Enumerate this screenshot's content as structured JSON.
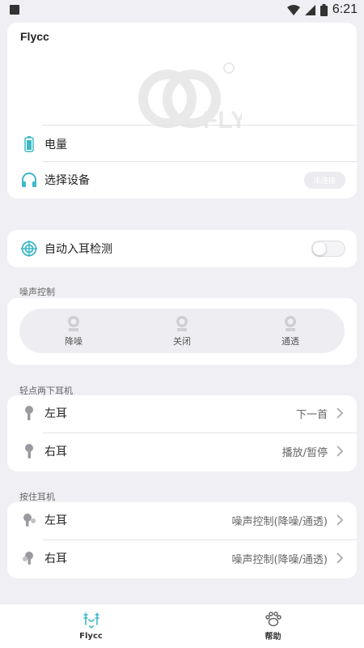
{
  "status_bar": {
    "time": "6:21"
  },
  "header": {
    "brand": "Flycc"
  },
  "device_card": {
    "battery_label": "电量",
    "select_device_label": "选择设备",
    "select_device_status": "未连接"
  },
  "auto_ear": {
    "label": "自动入耳检测",
    "enabled": false
  },
  "noise_control": {
    "title": "噪声控制",
    "options": [
      "降噪",
      "关闭",
      "通透"
    ]
  },
  "double_tap": {
    "title": "轻点两下耳机",
    "items": [
      {
        "label": "左耳",
        "value": "下一首"
      },
      {
        "label": "右耳",
        "value": "播放/暂停"
      }
    ]
  },
  "long_press": {
    "title": "按住耳机",
    "items": [
      {
        "label": "左耳",
        "value": "噪声控制(降噪/通透)"
      },
      {
        "label": "右耳",
        "value": "噪声控制(降噪/通透)"
      }
    ]
  },
  "bottom_nav": {
    "items": [
      {
        "label": "Flycc",
        "icon": "earbuds-icon",
        "active": true
      },
      {
        "label": "帮助",
        "icon": "paw-icon",
        "active": false
      }
    ]
  },
  "colors": {
    "accent": "#3fb8c8",
    "background": "#f0f0f4",
    "card": "#ffffff"
  }
}
